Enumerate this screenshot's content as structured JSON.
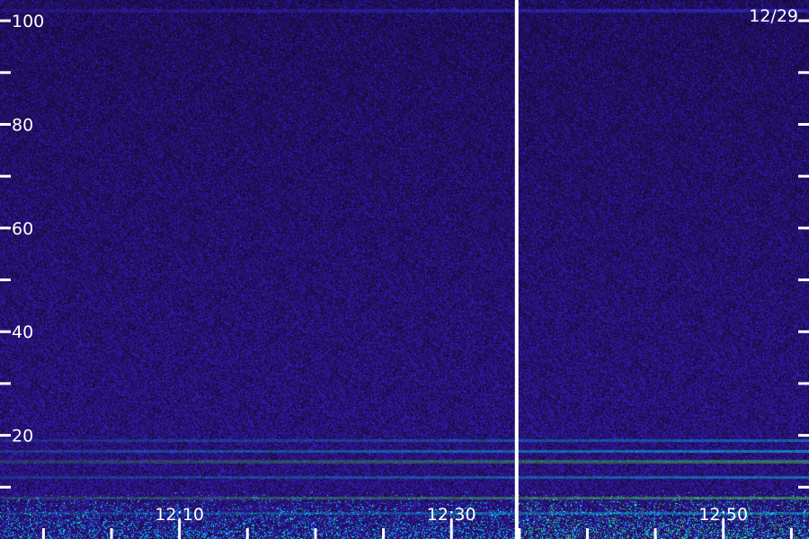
{
  "chart_data": {
    "type": "heatmap",
    "date_label": "12/29",
    "y_axis": {
      "range": [
        0,
        104
      ],
      "tick_labels": [
        "100",
        "80",
        "60",
        "40",
        "20"
      ],
      "label_values": [
        100,
        80,
        60,
        40,
        20
      ],
      "minor_tick_values": [
        90,
        70,
        50,
        30,
        10
      ]
    },
    "x_axis": {
      "range_minutes": [
        -3.2,
        56.3
      ],
      "tick_labels": [
        "12:10",
        "12:30",
        "12:50"
      ],
      "label_minutes": [
        10,
        30,
        50
      ],
      "minor_tick_minutes": [
        0,
        5,
        15,
        20,
        25,
        35,
        40,
        45,
        55
      ]
    },
    "marker_line_minutes": 34.8,
    "colors": {
      "background": "#1a0a52",
      "noise_high": "#3a1cc8",
      "band_cyan": "#00e8ff",
      "band_green": "#50ff40",
      "band_yellow": "#f0ff00",
      "marker": "#ffffff",
      "labels": "#ffffff"
    },
    "horizontal_bands": [
      {
        "value": 102,
        "color": "#3a3aff",
        "strength": 0.6
      },
      {
        "value": 19,
        "color": "#00c8ff",
        "strength": 0.5
      },
      {
        "value": 17,
        "color": "#00e8ff",
        "strength": 0.6
      },
      {
        "value": 15,
        "color": "#50ff40",
        "strength": 0.5
      },
      {
        "value": 12,
        "color": "#00e8ff",
        "strength": 0.5
      },
      {
        "value": 8,
        "color": "#50ff40",
        "strength": 0.55
      },
      {
        "value": 5,
        "color": "#00e8ff",
        "strength": 0.5
      }
    ]
  }
}
